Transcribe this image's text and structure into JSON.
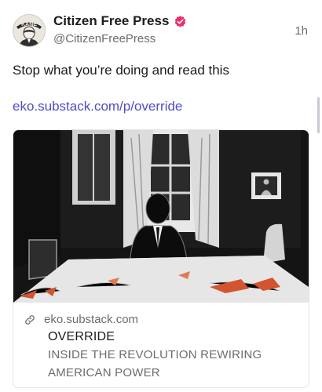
{
  "post": {
    "author_name": "Citizen Free Press",
    "author_handle": "@CitizenFreePress",
    "timestamp": "1h",
    "text": "Stop what you’re doing and read this",
    "link_text": "eko.substack.com/p/override",
    "verified_icon": "verified-badge-icon",
    "avatar_text": "KANE"
  },
  "card": {
    "domain": "eko.substack.com",
    "title": "OVERRIDE",
    "description": "INSIDE THE REVOLUTION REWIRING AMERICAN POWER",
    "image_description": "Black-and-white illustration of a man in a suit standing behind a long table in a dark room with tall windows and a framed portrait",
    "link_icon": "link-icon"
  },
  "colors": {
    "link": "#4f4cc9",
    "verified_badge": "#e8326e",
    "muted_text": "#6b6b72"
  }
}
